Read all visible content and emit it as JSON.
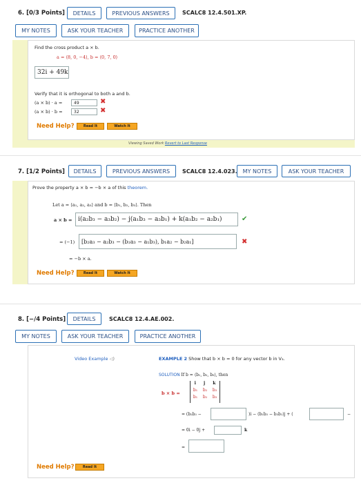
{
  "q6": {
    "label": "6. [0/3 Points]",
    "details": "DETAILS",
    "previous": "PREVIOUS ANSWERS",
    "ref": "SCALC8 12.4.501.XP.",
    "my_notes": "MY NOTES",
    "ask": "ASK YOUR TEACHER",
    "practice": "PRACTICE ANOTHER",
    "prompt": "Find the cross product a × b.",
    "vectors": "a = ⟨8, 0, −4⟩,   b = ⟨0, 7, 0⟩",
    "answer": "32i + 49k",
    "verify": "Verify that it is orthogonal to both a and b.",
    "dot_a_label": "(a × b) · a  =",
    "dot_a_value": "49",
    "dot_b_label": "(a × b) · b  =",
    "dot_b_value": "32",
    "need_help": "Need Help?",
    "read_it": "Read It",
    "watch_it": "Watch It",
    "saved": "Viewing Saved Work",
    "revert": "Revert to Last Response"
  },
  "q7": {
    "label": "7. [1/2 Points]",
    "details": "DETAILS",
    "previous": "PREVIOUS ANSWERS",
    "ref": "SCALC8 12.4.023.",
    "my_notes": "MY NOTES",
    "ask": "ASK YOUR TEACHER",
    "prompt_start": "Prove the property a × b = −b × a of this",
    "prompt_link": "theorem.",
    "let": "Let a = ⟨a₁, a₂, a₃⟩ and b = ⟨b₁, b₂, b₃⟩. Then",
    "line1_label": "a × b =",
    "line1_expr": "i(a₂b₃ − a₃b₂) − j(a₁b₃ − a₃b₁) + k(a₁b₂ − a₂b₁)",
    "line2_label": "= (−1)",
    "line2_expr": "[b₂a₃ − a₂b₃ − (b₁a₃ − a₁b₃), b₁a₂ − b₂a₁]",
    "line3": "= −b × a.",
    "need_help": "Need Help?",
    "read_it": "Read It",
    "watch_it": "Watch It"
  },
  "q8": {
    "label": "8. [−/4 Points]",
    "details": "DETAILS",
    "ref": "SCALC8 12.4.AE.002.",
    "my_notes": "MY NOTES",
    "ask": "ASK YOUR TEACHER",
    "practice": "PRACTICE ANOTHER",
    "video": "Video Example",
    "example_title": "EXAMPLE 2",
    "example_text": "Show that b × b = 0 for any vector b in V₃.",
    "solution_label": "SOLUTION",
    "solution_text": "If b = ⟨b₁, b₂, b₃⟩, then",
    "bxb": "b × b =",
    "det_row1": [
      "i",
      "j",
      "k"
    ],
    "det_row2": [
      "b₁",
      "b₂",
      "b₃"
    ],
    "det_row3": [
      "b₁",
      "b₂",
      "b₃"
    ],
    "eq1_start": "= (b₂b₃ −",
    "eq1_mid": ")i − (b₁b₃ − b₃b₁)j + (",
    "eq1_end": "−",
    "eq2_start": "= 0i − 0j +",
    "eq2_end": "k",
    "eq3": "=",
    "need_help": "Need Help?",
    "read_it": "Read It"
  }
}
